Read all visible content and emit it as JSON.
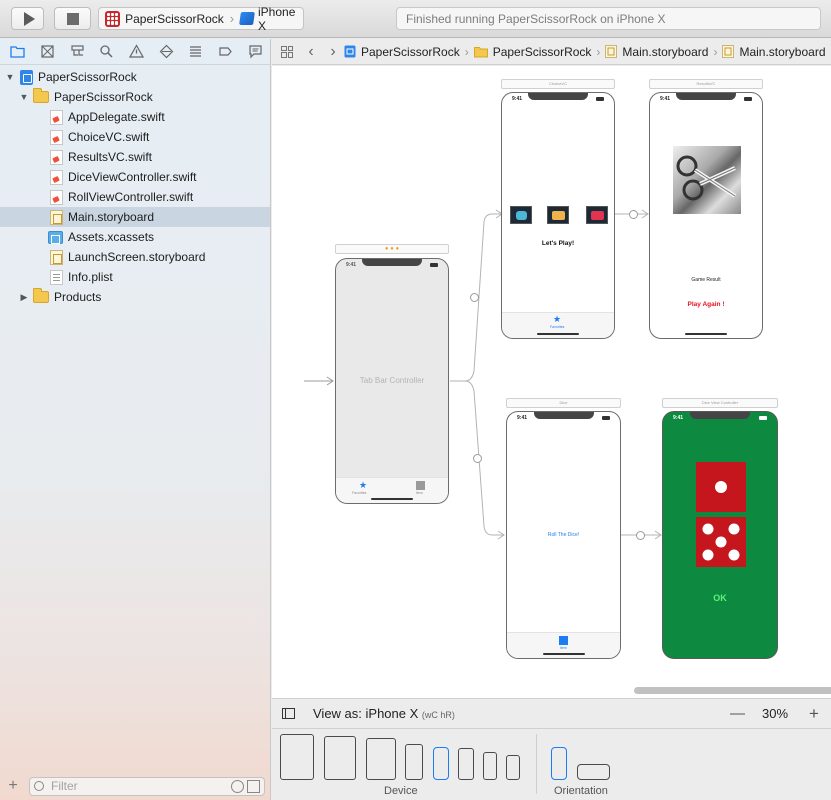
{
  "toolbar": {
    "run_icon": "play-icon",
    "stop_icon": "stop-icon",
    "scheme": "PaperScissorRock",
    "destination": "iPhone X",
    "activity": "Finished running PaperScissorRock on iPhone X"
  },
  "navigator": {
    "tabs": [
      "folder-icon",
      "source-control-icon",
      "symbol-icon",
      "find-icon",
      "issue-icon",
      "test-icon",
      "debug-icon",
      "breakpoint-icon",
      "report-icon"
    ],
    "items": [
      {
        "label": "PaperScissorRock",
        "type": "project"
      },
      {
        "label": "PaperScissorRock",
        "type": "group"
      },
      {
        "label": "AppDelegate.swift",
        "type": "swift"
      },
      {
        "label": "ChoiceVC.swift",
        "type": "swift"
      },
      {
        "label": "ResultsVC.swift",
        "type": "swift"
      },
      {
        "label": "DiceViewController.swift",
        "type": "swift"
      },
      {
        "label": "RollViewController.swift",
        "type": "swift"
      },
      {
        "label": "Main.storyboard",
        "type": "storyboard",
        "selected": true
      },
      {
        "label": "Assets.xcassets",
        "type": "assets"
      },
      {
        "label": "LaunchScreen.storyboard",
        "type": "storyboard"
      },
      {
        "label": "Info.plist",
        "type": "plist"
      },
      {
        "label": "Products",
        "type": "group"
      }
    ],
    "filter_placeholder": "Filter"
  },
  "jumpbar": {
    "crumbs": [
      "PaperScissorRock",
      "PaperScissorRock",
      "Main.storyboard",
      "Main.storyboard"
    ]
  },
  "storyboard": {
    "tab_bar_controller": {
      "title": "Tab Bar Controller",
      "tab1": "Favorites",
      "tab2": "Item"
    },
    "choice_vc": {
      "header": "ChoiceVC",
      "time": "9:41",
      "label": "Let's Play!",
      "tab": "Favorites"
    },
    "results_vc": {
      "header": "ResultsVC",
      "time": "9:41",
      "label": "Game Result",
      "button": "Play Again !"
    },
    "dice_vc": {
      "header": "Dice",
      "time": "9:41",
      "button": "Roll The Dice!",
      "tab": "Item"
    },
    "roll_vc": {
      "header": "Dice View Controller",
      "time": "9:41",
      "button": "OK"
    }
  },
  "bottom": {
    "view_as": "View as: iPhone X",
    "size_class": "(wC hR)",
    "zoom": "30%",
    "device_label": "Device",
    "orientation_label": "Orientation"
  },
  "colors": {
    "selection": "#c9d6e2",
    "accent": "#1d7cf2",
    "play_again_red": "#e6141e",
    "roll_green": "#0d8a3f",
    "die_red": "#c4161c"
  }
}
